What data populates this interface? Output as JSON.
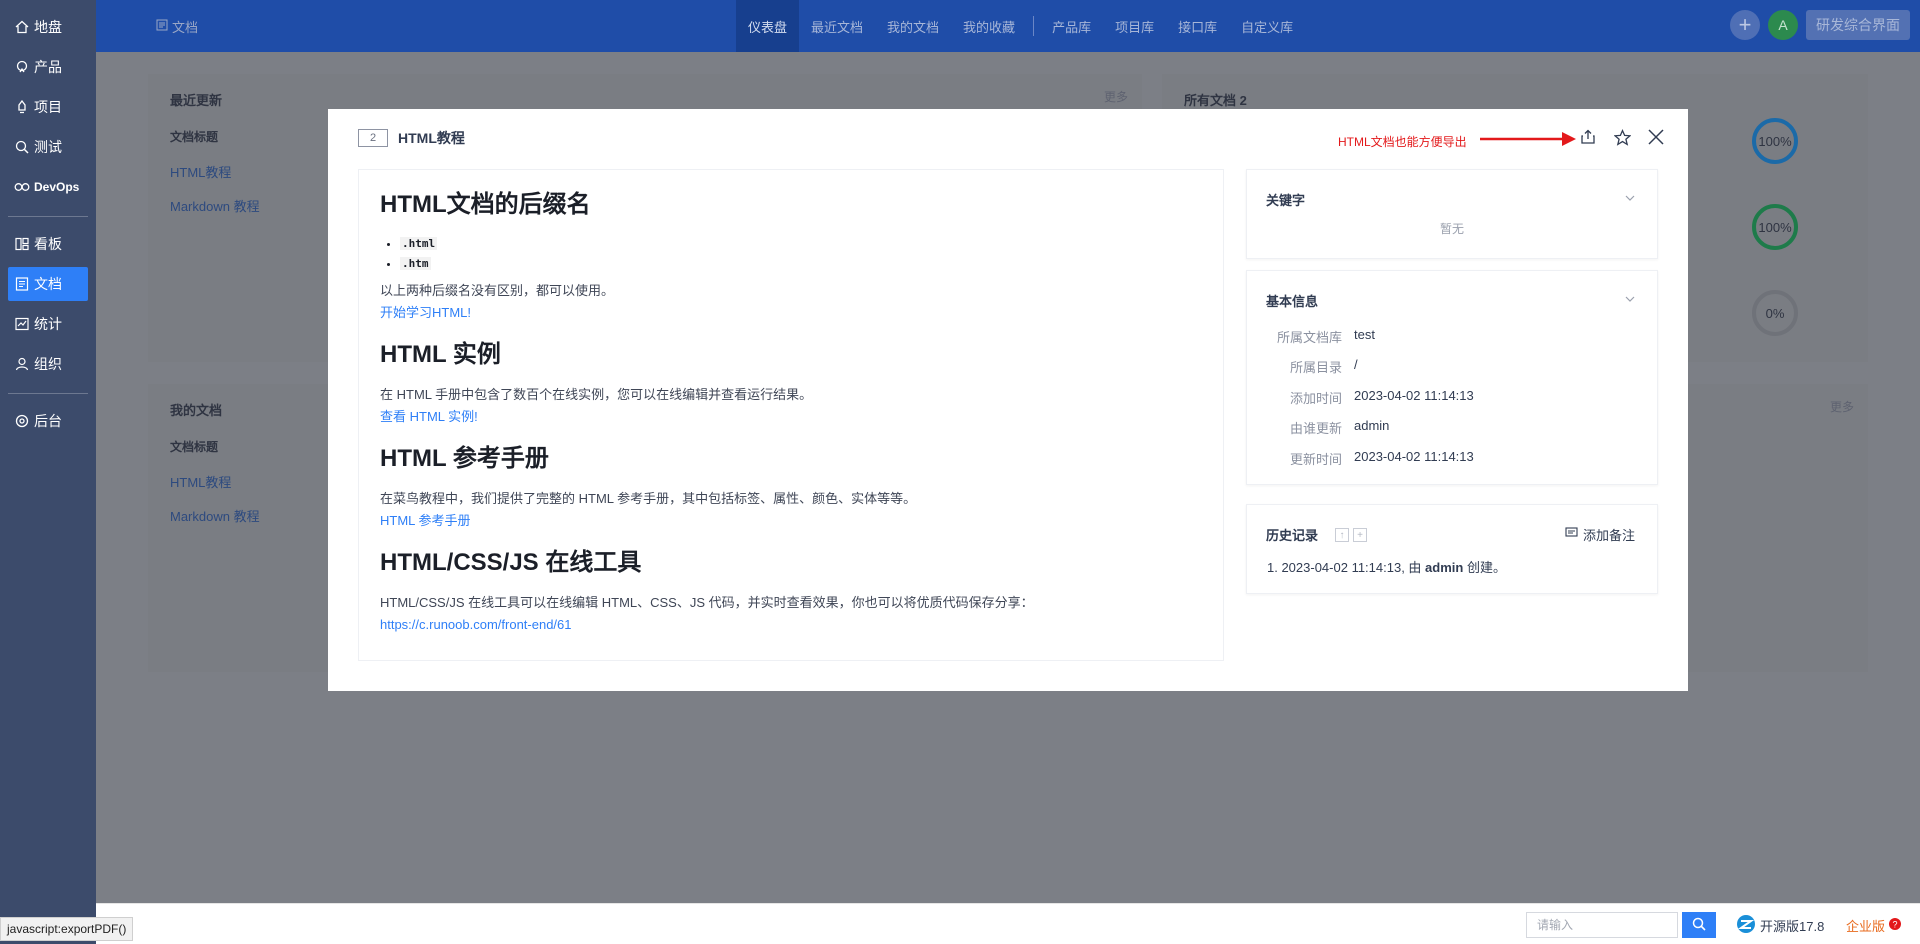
{
  "sidebar": {
    "items": [
      {
        "label": "地盘",
        "icon": "home-icon"
      },
      {
        "label": "产品",
        "icon": "product-icon"
      },
      {
        "label": "项目",
        "icon": "project-icon"
      },
      {
        "label": "测试",
        "icon": "test-icon"
      },
      {
        "label": "DevOps",
        "icon": "devops-icon"
      },
      {
        "label": "看板",
        "icon": "kanban-icon"
      },
      {
        "label": "文档",
        "icon": "doc-icon"
      },
      {
        "label": "统计",
        "icon": "chart-icon"
      },
      {
        "label": "组织",
        "icon": "org-icon"
      },
      {
        "label": "后台",
        "icon": "gear-icon"
      }
    ]
  },
  "topbar": {
    "crumb": "文档",
    "menu": [
      "仪表盘",
      "最近文档",
      "我的文档",
      "我的收藏",
      "产品库",
      "项目库",
      "接口库",
      "自定义库"
    ],
    "avatar": "A",
    "app_switch": "研发综合界面"
  },
  "panels": {
    "recent": {
      "title": "最近更新",
      "more": "更多",
      "col": "文档标题",
      "links": [
        "HTML教程",
        "Markdown 教程"
      ]
    },
    "all_docs": {
      "title": "所有文档 2",
      "gauges": [
        "100%",
        "100%",
        "0%"
      ]
    },
    "mine": {
      "title": "我的文档",
      "more": "更多",
      "col": "文档标题",
      "links": [
        "HTML教程",
        "Markdown 教程"
      ]
    }
  },
  "modal": {
    "badge": "2",
    "title": "HTML教程",
    "export_note": "HTML文档也能方便导出",
    "content": {
      "h1": "HTML文档的后缀名",
      "exts": [
        ".html",
        ".htm"
      ],
      "p1": "以上两种后缀名没有区别，都可以使用。",
      "a1": "开始学习HTML!",
      "h2": "HTML 实例",
      "p2": "在 HTML 手册中包含了数百个在线实例，您可以在线编辑并查看运行结果。",
      "a2": "查看 HTML 实例!",
      "h3": "HTML 参考手册",
      "p3": "在菜鸟教程中，我们提供了完整的 HTML 参考手册，其中包括标签、属性、颜色、实体等等。",
      "a3": "HTML 参考手册",
      "h4": "HTML/CSS/JS 在线工具",
      "p4": "HTML/CSS/JS 在线工具可以在线编辑 HTML、CSS、JS 代码，并实时查看效果，你也可以将优质代码保存分享：",
      "a4": "https://c.runoob.com/front-end/61"
    },
    "keywords": {
      "title": "关键字",
      "empty": "暂无"
    },
    "basic": {
      "title": "基本信息",
      "rows": [
        {
          "k": "所属文档库",
          "v": "test"
        },
        {
          "k": "所属目录",
          "v": "/"
        },
        {
          "k": "添加时间",
          "v": "2023-04-02 11:14:13"
        },
        {
          "k": "由谁更新",
          "v": "admin"
        },
        {
          "k": "更新时间",
          "v": "2023-04-02 11:14:13"
        }
      ]
    },
    "history": {
      "title": "历史记录",
      "add_note": "添加备注",
      "item_prefix": "1. 2023-04-02 11:14:13, 由 ",
      "item_user": "admin",
      "item_suffix": " 创建。"
    }
  },
  "bottom": {
    "search_placeholder": "请输入",
    "version": "开源版17.8",
    "enterprise": "企业版",
    "status_url": "javascript:exportPDF()"
  },
  "colors": {
    "accent": "#2e7ff7",
    "sidebar": "#3c4b6b",
    "topbar": "#1f4da8",
    "export_note": "#e3191b"
  }
}
